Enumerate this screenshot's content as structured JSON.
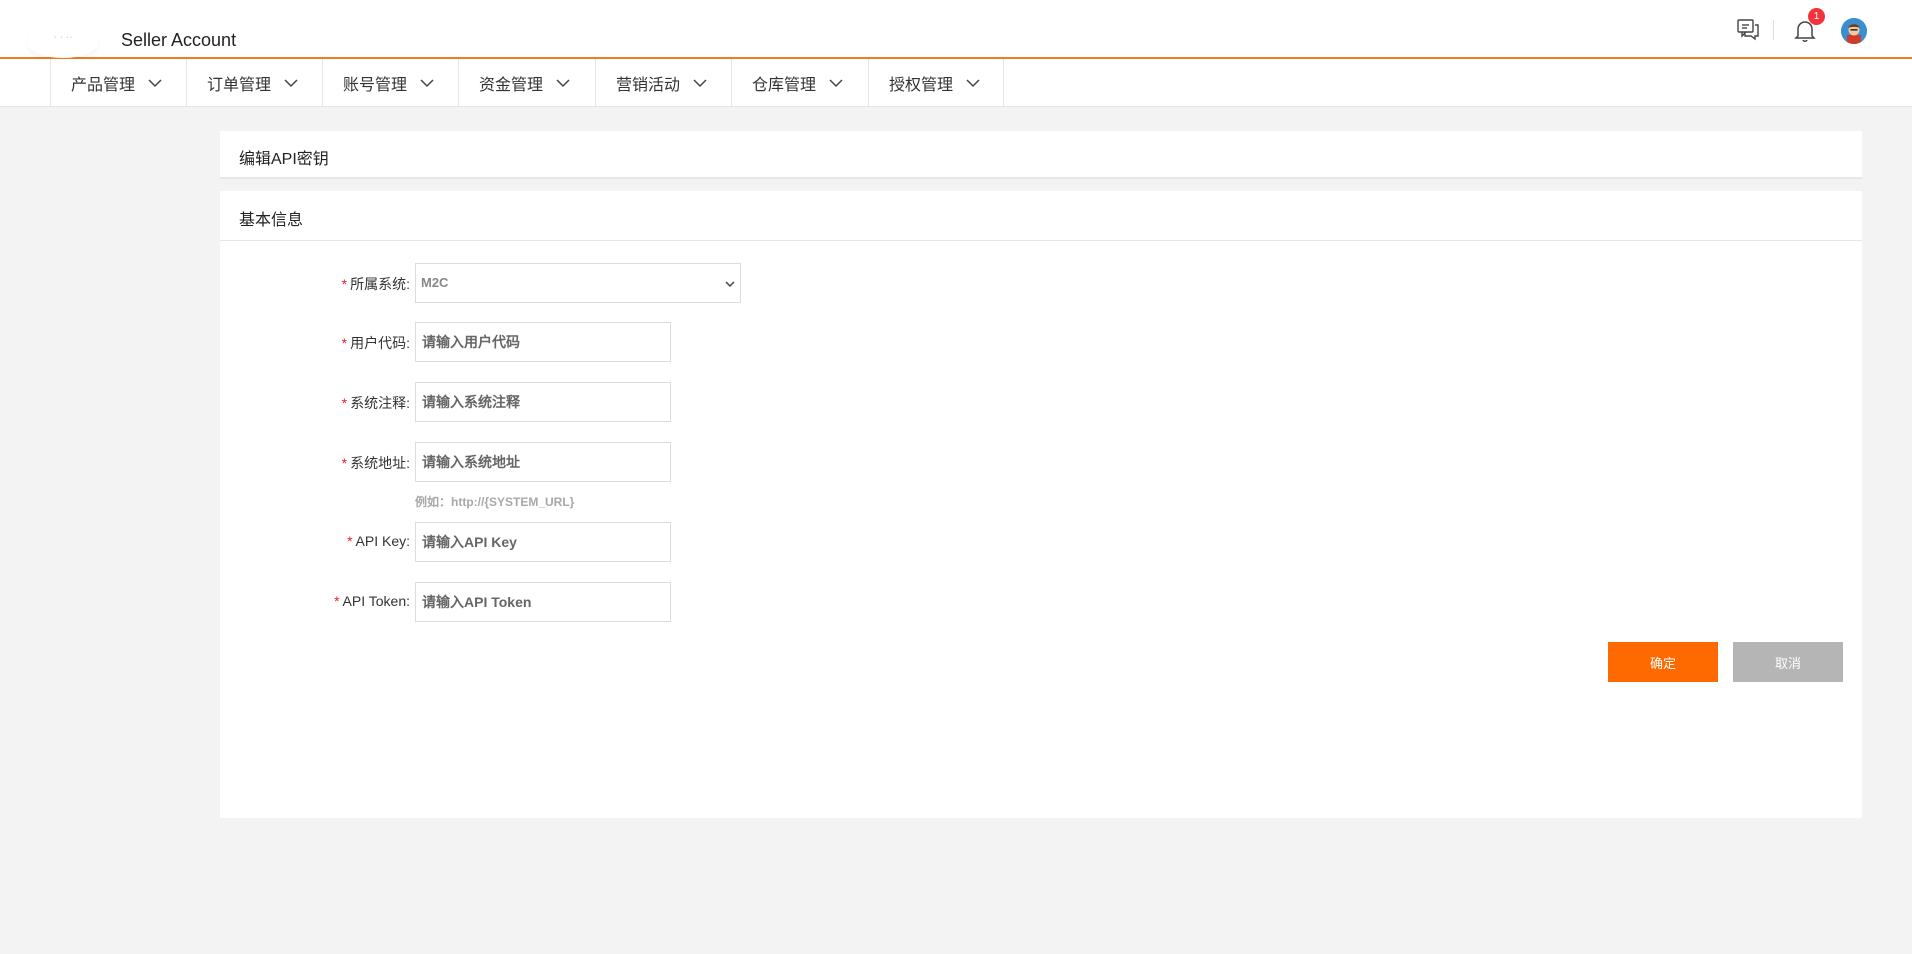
{
  "header": {
    "logo_text": "·  ·  ··",
    "app_title": "Seller Account",
    "notification_count": "1"
  },
  "nav": {
    "items": [
      {
        "label": "产品管理"
      },
      {
        "label": "订单管理"
      },
      {
        "label": "账号管理"
      },
      {
        "label": "资金管理"
      },
      {
        "label": "营销活动"
      },
      {
        "label": "仓库管理"
      },
      {
        "label": "授权管理"
      }
    ]
  },
  "page": {
    "title": "编辑API密钥",
    "section_title": "基本信息"
  },
  "form": {
    "required_mark": "*",
    "system": {
      "label": "所属系统:",
      "value": "M2C"
    },
    "user_code": {
      "label": "用户代码:",
      "placeholder": "请输入用户代码"
    },
    "system_note": {
      "label": "系统注释:",
      "placeholder": "请输入系统注释"
    },
    "system_url": {
      "label": "系统地址:",
      "placeholder": "请输入系统地址",
      "hint": "例如：http://{SYSTEM_URL}"
    },
    "api_key": {
      "label": "API Key:",
      "placeholder": "请输入API Key"
    },
    "api_token": {
      "label": "API Token:",
      "placeholder": "请输入API Token"
    }
  },
  "actions": {
    "confirm": "确定",
    "cancel": "取消"
  },
  "colors": {
    "accent": "#ff6a00",
    "header_border": "#f07c22",
    "cancel": "#b5b5b5",
    "required": "#e5202e"
  }
}
